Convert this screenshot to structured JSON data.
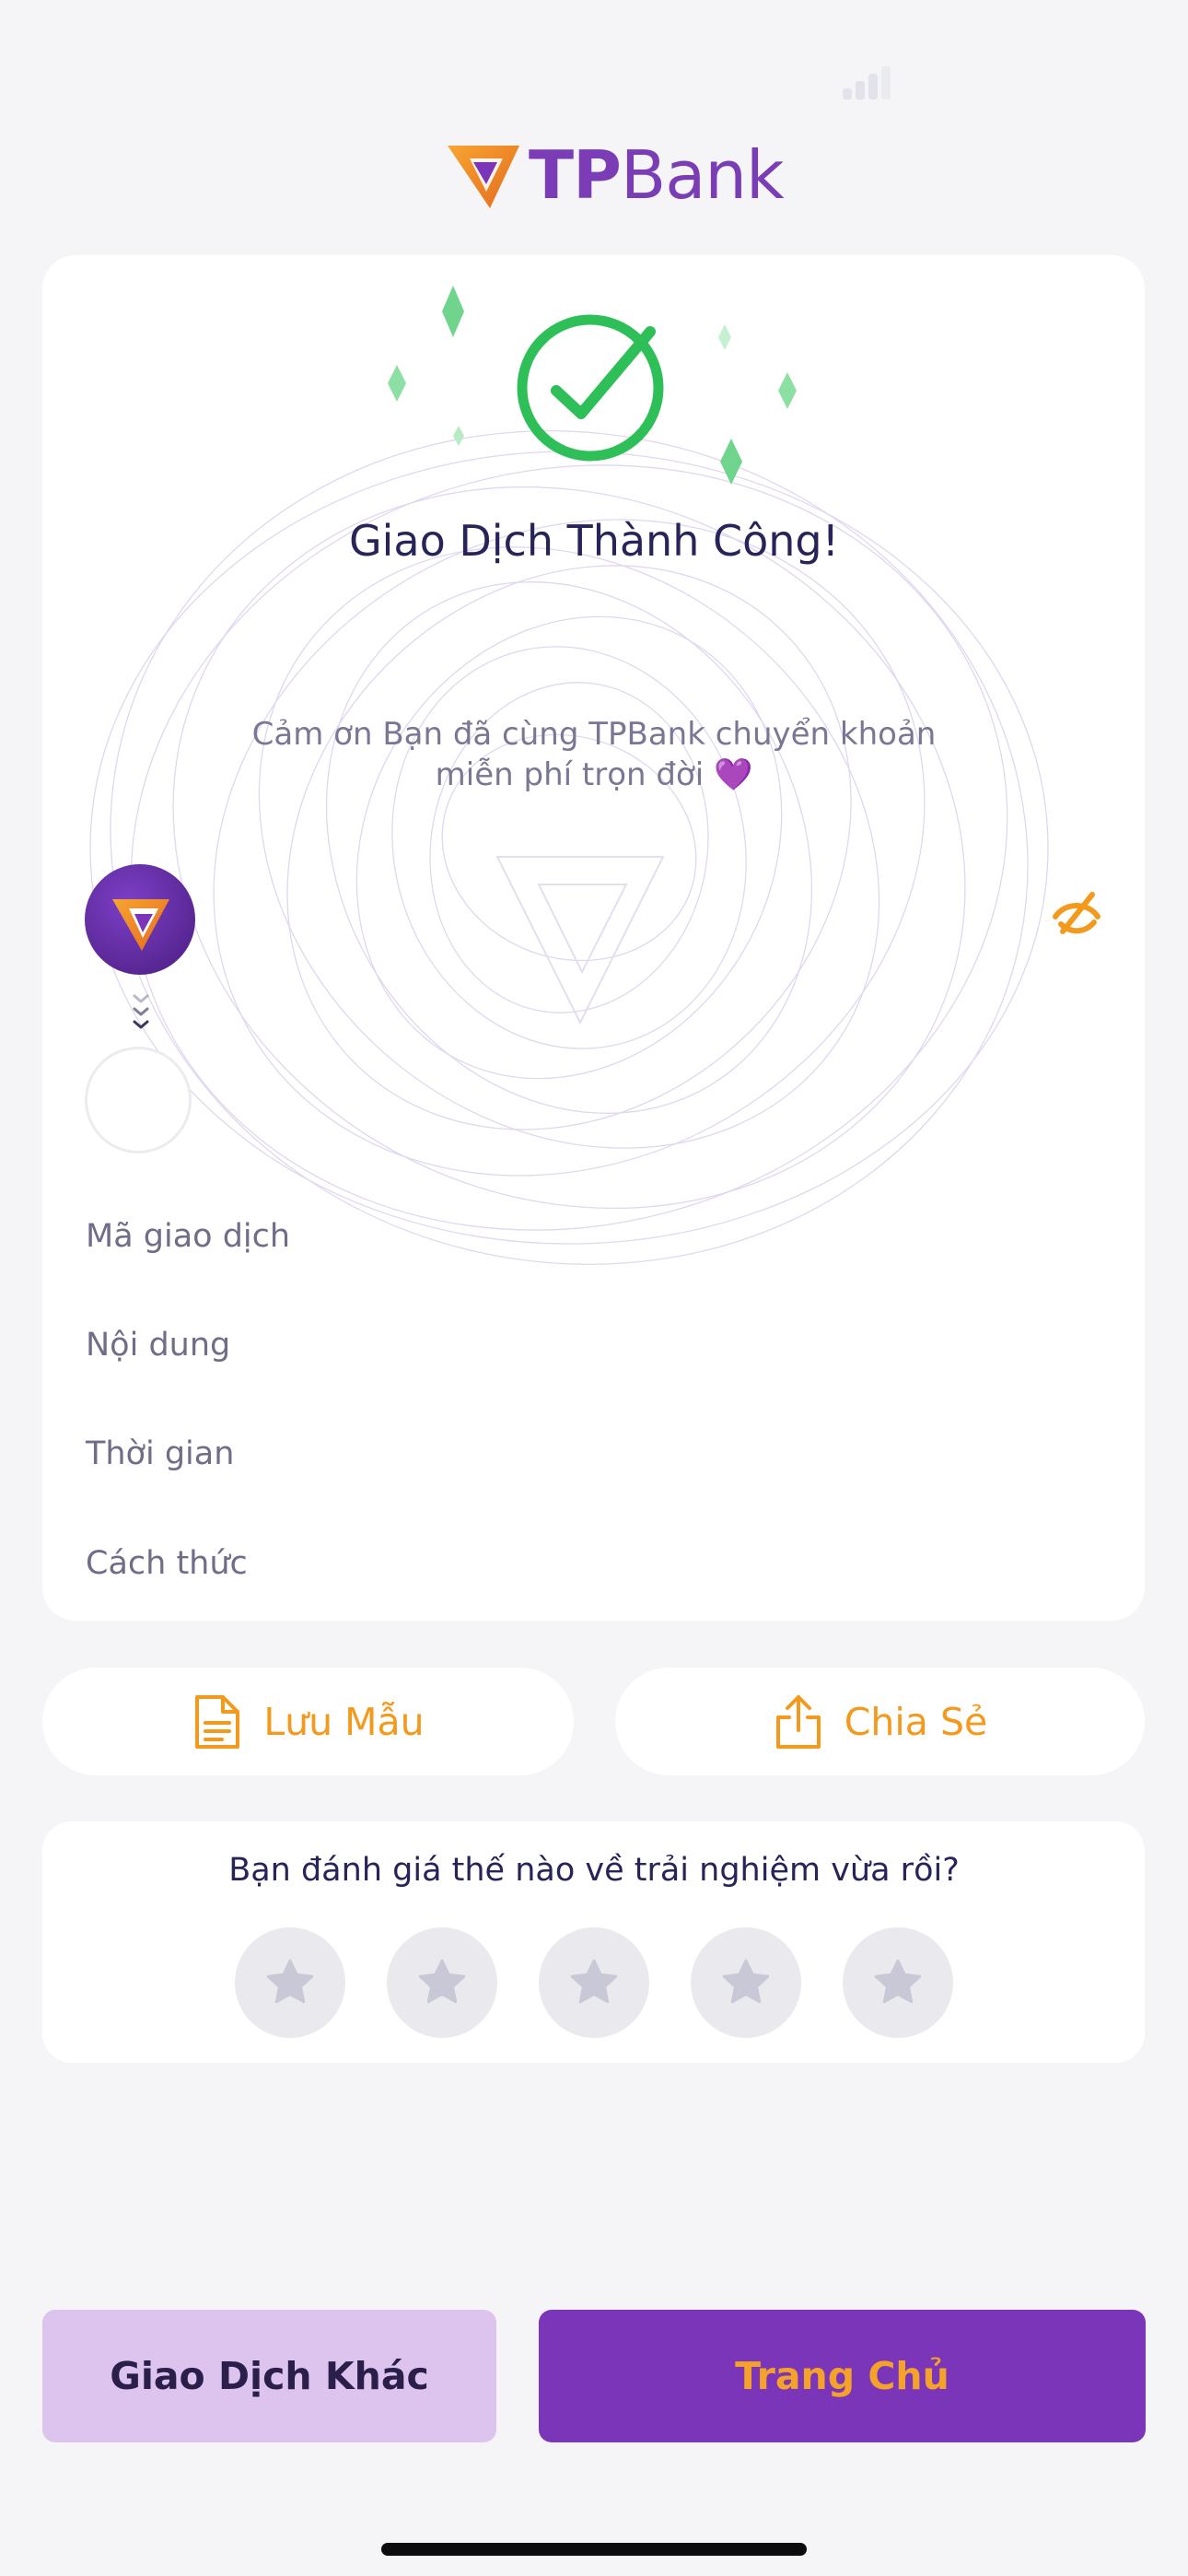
{
  "brand": {
    "logo_bold": "TP",
    "logo_rest": "Bank"
  },
  "result": {
    "title": "Giao Dịch Thành Công!",
    "thanks_line1": "Cảm ơn Bạn đã cùng TPBank chuyển khoản",
    "thanks_line2": "miễn phí trọn đời 💜"
  },
  "details": {
    "rows": [
      {
        "label": "Mã giao dịch"
      },
      {
        "label": "Nội dung"
      },
      {
        "label": "Thời gian"
      },
      {
        "label": "Cách thức"
      }
    ]
  },
  "actions": {
    "save_template": "Lưu Mẫu",
    "share": "Chia Sẻ"
  },
  "rating": {
    "question": "Bạn đánh giá thế nào về trải nghiệm vừa rồi?",
    "stars_selected": 0,
    "stars_total": 5
  },
  "footer": {
    "other_transaction": "Giao Dịch Khác",
    "home": "Trang Chủ"
  },
  "colors": {
    "brand_purple": "#7b35b8",
    "brand_orange": "#f39a1d",
    "success_green": "#2fbf58"
  },
  "icons": [
    "signal-icon",
    "tpbank-logo-icon",
    "success-check-icon",
    "sparkle-icon",
    "hide-eye-icon",
    "chevrons-down-icon",
    "document-icon",
    "share-icon",
    "star-icon"
  ]
}
